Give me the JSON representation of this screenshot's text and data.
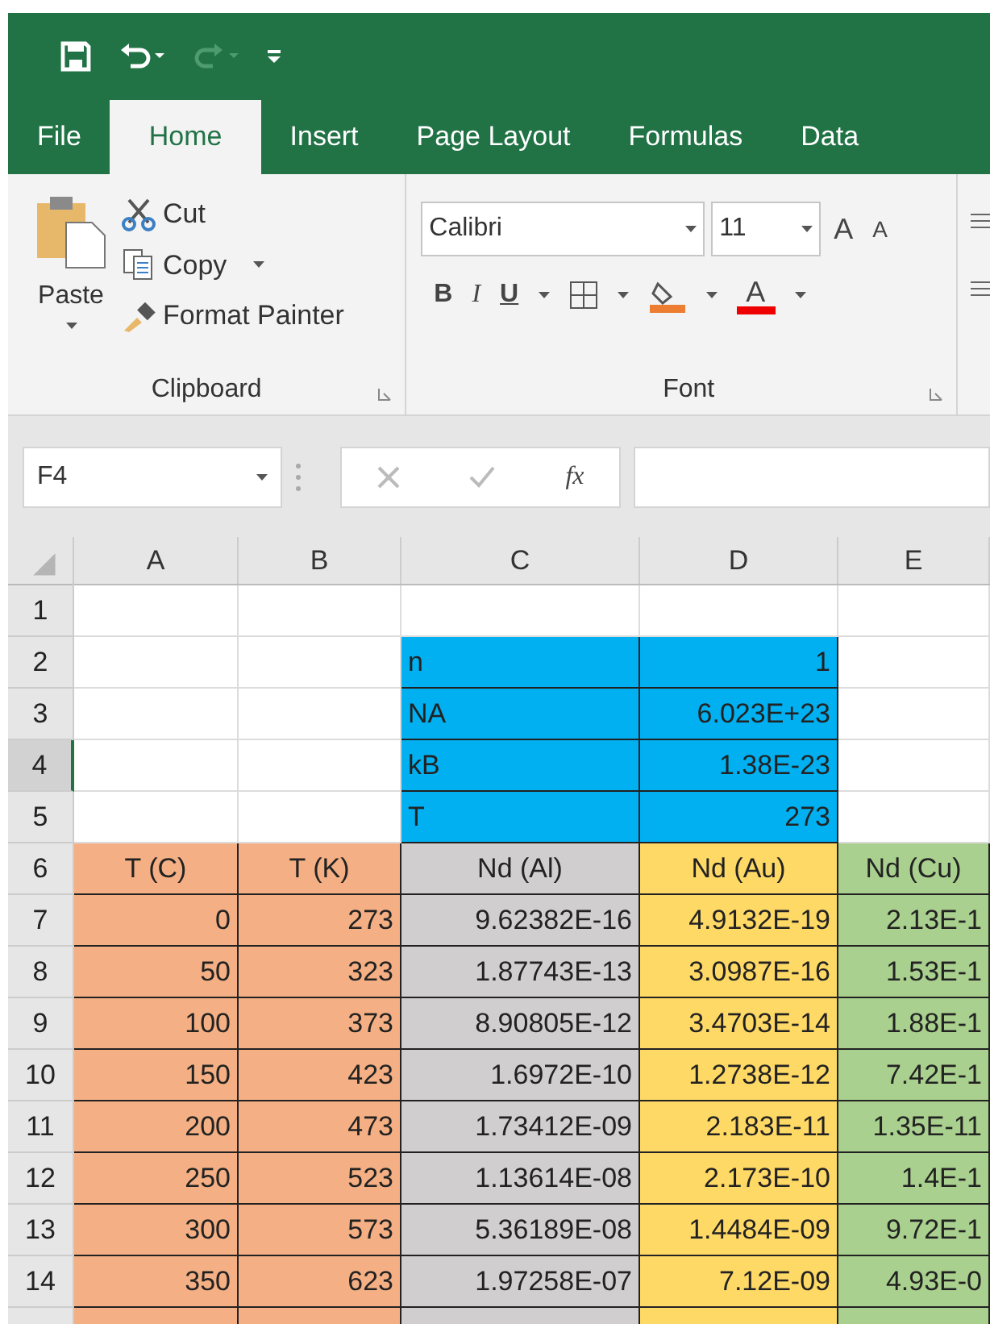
{
  "tabs": [
    {
      "label": "File",
      "selected": false
    },
    {
      "label": "Home",
      "selected": true
    },
    {
      "label": "Insert",
      "selected": false
    },
    {
      "label": "Page Layout",
      "selected": false
    },
    {
      "label": "Formulas",
      "selected": false
    },
    {
      "label": "Data",
      "selected": false
    }
  ],
  "clipboard": {
    "paste": "Paste",
    "cut": "Cut",
    "copy": "Copy",
    "format_painter": "Format Painter",
    "group_label": "Clipboard"
  },
  "font": {
    "name": "Calibri",
    "size": "11",
    "grow": "A",
    "shrink": "A",
    "bold": "B",
    "italic": "I",
    "underline": "U",
    "font_color": "A",
    "group_label": "Font"
  },
  "formula_bar": {
    "name_box": "F4",
    "fx": "fx"
  },
  "columns": [
    "A",
    "B",
    "C",
    "D",
    "E"
  ],
  "rows": [
    {
      "number": "1",
      "selected": false,
      "cells": [
        {},
        {},
        {},
        {},
        {}
      ]
    },
    {
      "number": "2",
      "selected": false,
      "cells": [
        {},
        {},
        {
          "text": "n",
          "color": "#00b0f0"
        },
        {
          "text": "1",
          "color": "#00b0f0"
        },
        {}
      ]
    },
    {
      "number": "3",
      "selected": false,
      "cells": [
        {},
        {},
        {
          "text": "NA",
          "color": "#00b0f0"
        },
        {
          "text": "6.023E+23",
          "color": "#00b0f0"
        },
        {}
      ]
    },
    {
      "number": "4",
      "selected": true,
      "cells": [
        {},
        {},
        {
          "text": "kB",
          "color": "#00b0f0"
        },
        {
          "text": "1.38E-23",
          "color": "#00b0f0"
        },
        {}
      ]
    },
    {
      "number": "5",
      "selected": false,
      "cells": [
        {},
        {},
        {
          "text": "T",
          "color": "#00b0f0"
        },
        {
          "text": "273",
          "color": "#00b0f0"
        },
        {}
      ]
    },
    {
      "number": "6",
      "selected": false,
      "cells": [
        {
          "text": "T (C)",
          "color": "#f4b084",
          "kind": "header"
        },
        {
          "text": "T (K)",
          "color": "#f4b084",
          "kind": "header"
        },
        {
          "text": "Nd (Al)",
          "color": "#d0cece",
          "kind": "header"
        },
        {
          "text": "Nd (Au)",
          "color": "#ffd966",
          "kind": "header"
        },
        {
          "text": "Nd (Cu)",
          "color": "#a9d08e",
          "kind": "header"
        }
      ]
    },
    {
      "number": "7",
      "selected": false,
      "cells": [
        {
          "text": "0",
          "color": "#f4b084"
        },
        {
          "text": "273",
          "color": "#f4b084"
        },
        {
          "text": "9.62382E-16",
          "color": "#d0cece"
        },
        {
          "text": "4.9132E-19",
          "color": "#ffd966"
        },
        {
          "text": "2.13E-1",
          "color": "#a9d08e"
        }
      ]
    },
    {
      "number": "8",
      "selected": false,
      "cells": [
        {
          "text": "50",
          "color": "#f4b084"
        },
        {
          "text": "323",
          "color": "#f4b084"
        },
        {
          "text": "1.87743E-13",
          "color": "#d0cece"
        },
        {
          "text": "3.0987E-16",
          "color": "#ffd966"
        },
        {
          "text": "1.53E-1",
          "color": "#a9d08e"
        }
      ]
    },
    {
      "number": "9",
      "selected": false,
      "cells": [
        {
          "text": "100",
          "color": "#f4b084"
        },
        {
          "text": "373",
          "color": "#f4b084"
        },
        {
          "text": "8.90805E-12",
          "color": "#d0cece"
        },
        {
          "text": "3.4703E-14",
          "color": "#ffd966"
        },
        {
          "text": "1.88E-1",
          "color": "#a9d08e"
        }
      ]
    },
    {
      "number": "10",
      "selected": false,
      "cells": [
        {
          "text": "150",
          "color": "#f4b084"
        },
        {
          "text": "423",
          "color": "#f4b084"
        },
        {
          "text": "1.6972E-10",
          "color": "#d0cece"
        },
        {
          "text": "1.2738E-12",
          "color": "#ffd966"
        },
        {
          "text": "7.42E-1",
          "color": "#a9d08e"
        }
      ]
    },
    {
      "number": "11",
      "selected": false,
      "cells": [
        {
          "text": "200",
          "color": "#f4b084"
        },
        {
          "text": "473",
          "color": "#f4b084"
        },
        {
          "text": "1.73412E-09",
          "color": "#d0cece"
        },
        {
          "text": "2.183E-11",
          "color": "#ffd966"
        },
        {
          "text": "1.35E-11",
          "color": "#a9d08e"
        }
      ]
    },
    {
      "number": "12",
      "selected": false,
      "cells": [
        {
          "text": "250",
          "color": "#f4b084"
        },
        {
          "text": "523",
          "color": "#f4b084"
        },
        {
          "text": "1.13614E-08",
          "color": "#d0cece"
        },
        {
          "text": "2.173E-10",
          "color": "#ffd966"
        },
        {
          "text": "1.4E-1",
          "color": "#a9d08e"
        }
      ]
    },
    {
      "number": "13",
      "selected": false,
      "cells": [
        {
          "text": "300",
          "color": "#f4b084"
        },
        {
          "text": "573",
          "color": "#f4b084"
        },
        {
          "text": "5.36189E-08",
          "color": "#d0cece"
        },
        {
          "text": "1.4484E-09",
          "color": "#ffd966"
        },
        {
          "text": "9.72E-1",
          "color": "#a9d08e"
        }
      ]
    },
    {
      "number": "14",
      "selected": false,
      "cells": [
        {
          "text": "350",
          "color": "#f4b084"
        },
        {
          "text": "623",
          "color": "#f4b084"
        },
        {
          "text": "1.97258E-07",
          "color": "#d0cece"
        },
        {
          "text": "7.12E-09",
          "color": "#ffd966"
        },
        {
          "text": "4.93E-0",
          "color": "#a9d08e"
        }
      ]
    },
    {
      "selected": false,
      "cells": [
        {
          "color": "#f4b084"
        },
        {
          "color": "#f4b084"
        },
        {
          "color": "#d0cece"
        },
        {
          "color": "#ffd966"
        },
        {
          "color": "#a9d08e"
        }
      ]
    }
  ]
}
